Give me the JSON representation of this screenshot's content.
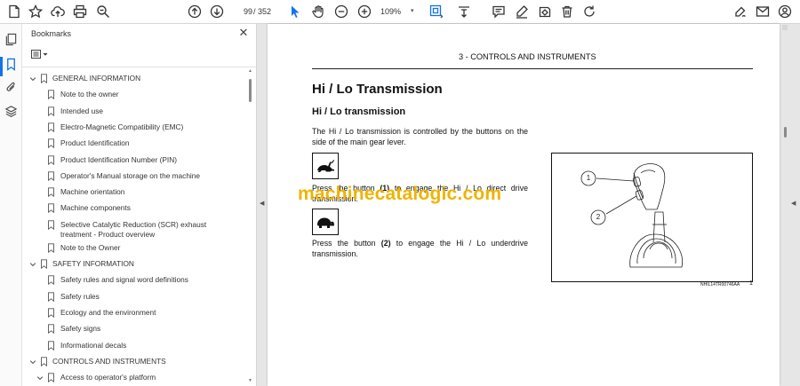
{
  "toolbar": {
    "page_current": "99",
    "page_total": "/ 352",
    "zoom": "109%",
    "zoom_caret": "▾"
  },
  "bookmarks_panel": {
    "title": "Bookmarks",
    "close_glyph": "✕",
    "items": [
      {
        "label": "GENERAL INFORMATION",
        "level": 0,
        "expanded": true
      },
      {
        "label": "Note to the owner",
        "level": 1
      },
      {
        "label": "Intended use",
        "level": 1
      },
      {
        "label": "Electro-Magnetic Compatibility (EMC)",
        "level": 1
      },
      {
        "label": "Product Identification",
        "level": 1
      },
      {
        "label": "Product Identification Number (PIN)",
        "level": 1
      },
      {
        "label": "Operator's Manual storage on the machine",
        "level": 1
      },
      {
        "label": "Machine orientation",
        "level": 1
      },
      {
        "label": "Machine components",
        "level": 1
      },
      {
        "label": "Selective Catalytic Reduction (SCR) exhaust treatment - Product overview",
        "level": 1
      },
      {
        "label": "Note to the Owner",
        "level": 1
      },
      {
        "label": "SAFETY INFORMATION",
        "level": 0,
        "expanded": true
      },
      {
        "label": "Safety rules and signal word definitions",
        "level": 1
      },
      {
        "label": "Safety rules",
        "level": 1
      },
      {
        "label": "Ecology and the environment",
        "level": 1
      },
      {
        "label": "Safety signs",
        "level": 1
      },
      {
        "label": "Informational decals",
        "level": 1
      },
      {
        "label": "CONTROLS AND INSTRUMENTS",
        "level": 0,
        "expanded": true
      },
      {
        "label": "Access to operator's platform",
        "level": 1,
        "expanded": true
      }
    ]
  },
  "document": {
    "section_header": "3 - CONTROLS AND INSTRUMENTS",
    "title": "Hi / Lo Transmission",
    "subtitle": "Hi / Lo transmission",
    "para1": "The Hi / Lo transmission is controlled by the buttons on the side of the main gear lever.",
    "para2_a": "Press the button ",
    "para2_b": "(1)",
    "para2_c": " to engage the Hi / Lo direct drive transmission.",
    "para3_a": "Press the button ",
    "para3_b": "(2)",
    "para3_c": " to engage the Hi / Lo underdrive transmission.",
    "figure_callout_1": "1",
    "figure_callout_2": "2",
    "figure_code": "NHIL14TR00746AA",
    "figure_number": "1",
    "watermark": "machinecatalogic.com"
  },
  "colors": {
    "accent": "#1473e6",
    "watermark": "#efb400"
  }
}
